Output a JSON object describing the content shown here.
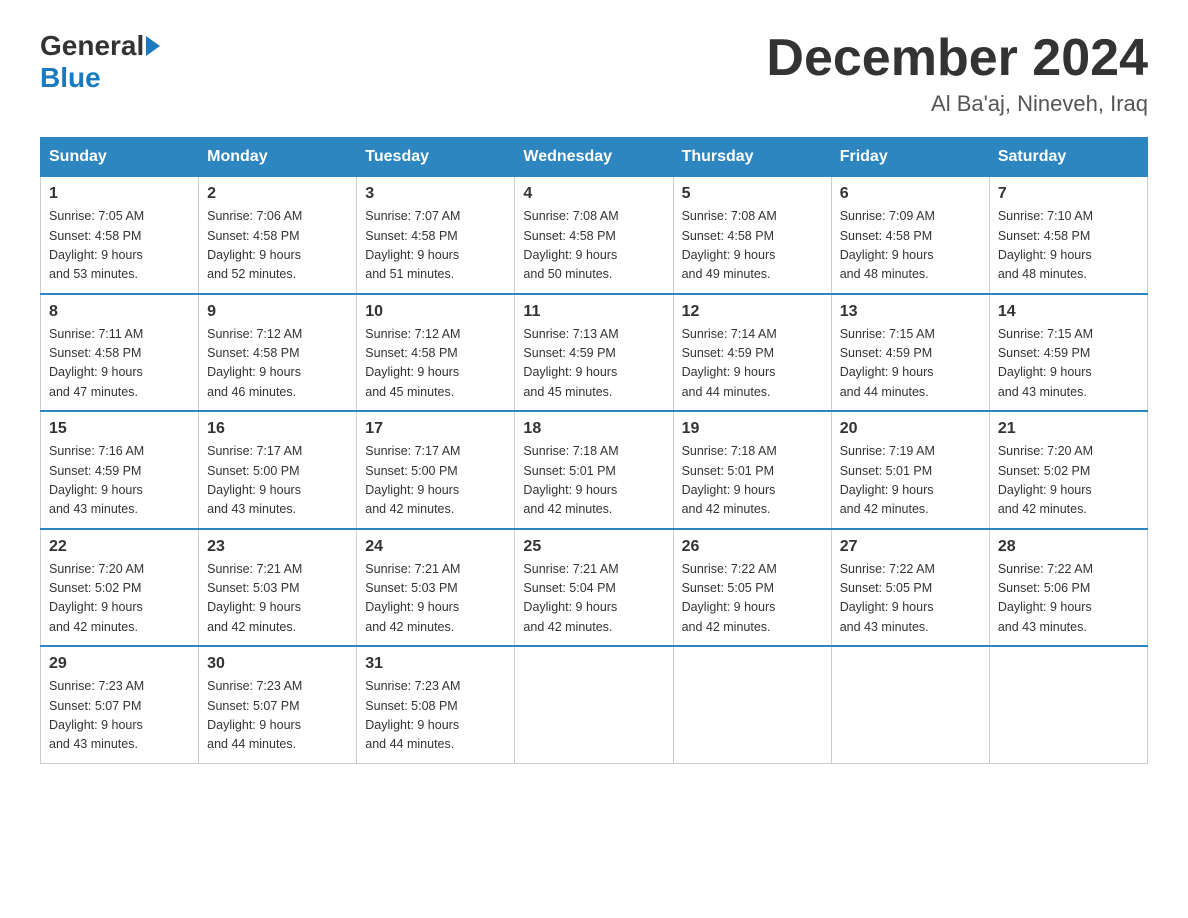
{
  "header": {
    "logo_general": "General",
    "logo_blue": "Blue",
    "month_title": "December 2024",
    "location": "Al Ba'aj, Nineveh, Iraq"
  },
  "weekdays": [
    "Sunday",
    "Monday",
    "Tuesday",
    "Wednesday",
    "Thursday",
    "Friday",
    "Saturday"
  ],
  "weeks": [
    [
      {
        "day": "1",
        "sunrise": "7:05 AM",
        "sunset": "4:58 PM",
        "daylight": "9 hours and 53 minutes."
      },
      {
        "day": "2",
        "sunrise": "7:06 AM",
        "sunset": "4:58 PM",
        "daylight": "9 hours and 52 minutes."
      },
      {
        "day": "3",
        "sunrise": "7:07 AM",
        "sunset": "4:58 PM",
        "daylight": "9 hours and 51 minutes."
      },
      {
        "day": "4",
        "sunrise": "7:08 AM",
        "sunset": "4:58 PM",
        "daylight": "9 hours and 50 minutes."
      },
      {
        "day": "5",
        "sunrise": "7:08 AM",
        "sunset": "4:58 PM",
        "daylight": "9 hours and 49 minutes."
      },
      {
        "day": "6",
        "sunrise": "7:09 AM",
        "sunset": "4:58 PM",
        "daylight": "9 hours and 48 minutes."
      },
      {
        "day": "7",
        "sunrise": "7:10 AM",
        "sunset": "4:58 PM",
        "daylight": "9 hours and 48 minutes."
      }
    ],
    [
      {
        "day": "8",
        "sunrise": "7:11 AM",
        "sunset": "4:58 PM",
        "daylight": "9 hours and 47 minutes."
      },
      {
        "day": "9",
        "sunrise": "7:12 AM",
        "sunset": "4:58 PM",
        "daylight": "9 hours and 46 minutes."
      },
      {
        "day": "10",
        "sunrise": "7:12 AM",
        "sunset": "4:58 PM",
        "daylight": "9 hours and 45 minutes."
      },
      {
        "day": "11",
        "sunrise": "7:13 AM",
        "sunset": "4:59 PM",
        "daylight": "9 hours and 45 minutes."
      },
      {
        "day": "12",
        "sunrise": "7:14 AM",
        "sunset": "4:59 PM",
        "daylight": "9 hours and 44 minutes."
      },
      {
        "day": "13",
        "sunrise": "7:15 AM",
        "sunset": "4:59 PM",
        "daylight": "9 hours and 44 minutes."
      },
      {
        "day": "14",
        "sunrise": "7:15 AM",
        "sunset": "4:59 PM",
        "daylight": "9 hours and 43 minutes."
      }
    ],
    [
      {
        "day": "15",
        "sunrise": "7:16 AM",
        "sunset": "4:59 PM",
        "daylight": "9 hours and 43 minutes."
      },
      {
        "day": "16",
        "sunrise": "7:17 AM",
        "sunset": "5:00 PM",
        "daylight": "9 hours and 43 minutes."
      },
      {
        "day": "17",
        "sunrise": "7:17 AM",
        "sunset": "5:00 PM",
        "daylight": "9 hours and 42 minutes."
      },
      {
        "day": "18",
        "sunrise": "7:18 AM",
        "sunset": "5:01 PM",
        "daylight": "9 hours and 42 minutes."
      },
      {
        "day": "19",
        "sunrise": "7:18 AM",
        "sunset": "5:01 PM",
        "daylight": "9 hours and 42 minutes."
      },
      {
        "day": "20",
        "sunrise": "7:19 AM",
        "sunset": "5:01 PM",
        "daylight": "9 hours and 42 minutes."
      },
      {
        "day": "21",
        "sunrise": "7:20 AM",
        "sunset": "5:02 PM",
        "daylight": "9 hours and 42 minutes."
      }
    ],
    [
      {
        "day": "22",
        "sunrise": "7:20 AM",
        "sunset": "5:02 PM",
        "daylight": "9 hours and 42 minutes."
      },
      {
        "day": "23",
        "sunrise": "7:21 AM",
        "sunset": "5:03 PM",
        "daylight": "9 hours and 42 minutes."
      },
      {
        "day": "24",
        "sunrise": "7:21 AM",
        "sunset": "5:03 PM",
        "daylight": "9 hours and 42 minutes."
      },
      {
        "day": "25",
        "sunrise": "7:21 AM",
        "sunset": "5:04 PM",
        "daylight": "9 hours and 42 minutes."
      },
      {
        "day": "26",
        "sunrise": "7:22 AM",
        "sunset": "5:05 PM",
        "daylight": "9 hours and 42 minutes."
      },
      {
        "day": "27",
        "sunrise": "7:22 AM",
        "sunset": "5:05 PM",
        "daylight": "9 hours and 43 minutes."
      },
      {
        "day": "28",
        "sunrise": "7:22 AM",
        "sunset": "5:06 PM",
        "daylight": "9 hours and 43 minutes."
      }
    ],
    [
      {
        "day": "29",
        "sunrise": "7:23 AM",
        "sunset": "5:07 PM",
        "daylight": "9 hours and 43 minutes."
      },
      {
        "day": "30",
        "sunrise": "7:23 AM",
        "sunset": "5:07 PM",
        "daylight": "9 hours and 44 minutes."
      },
      {
        "day": "31",
        "sunrise": "7:23 AM",
        "sunset": "5:08 PM",
        "daylight": "9 hours and 44 minutes."
      },
      null,
      null,
      null,
      null
    ]
  ],
  "labels": {
    "sunrise": "Sunrise:",
    "sunset": "Sunset:",
    "daylight": "Daylight:"
  }
}
